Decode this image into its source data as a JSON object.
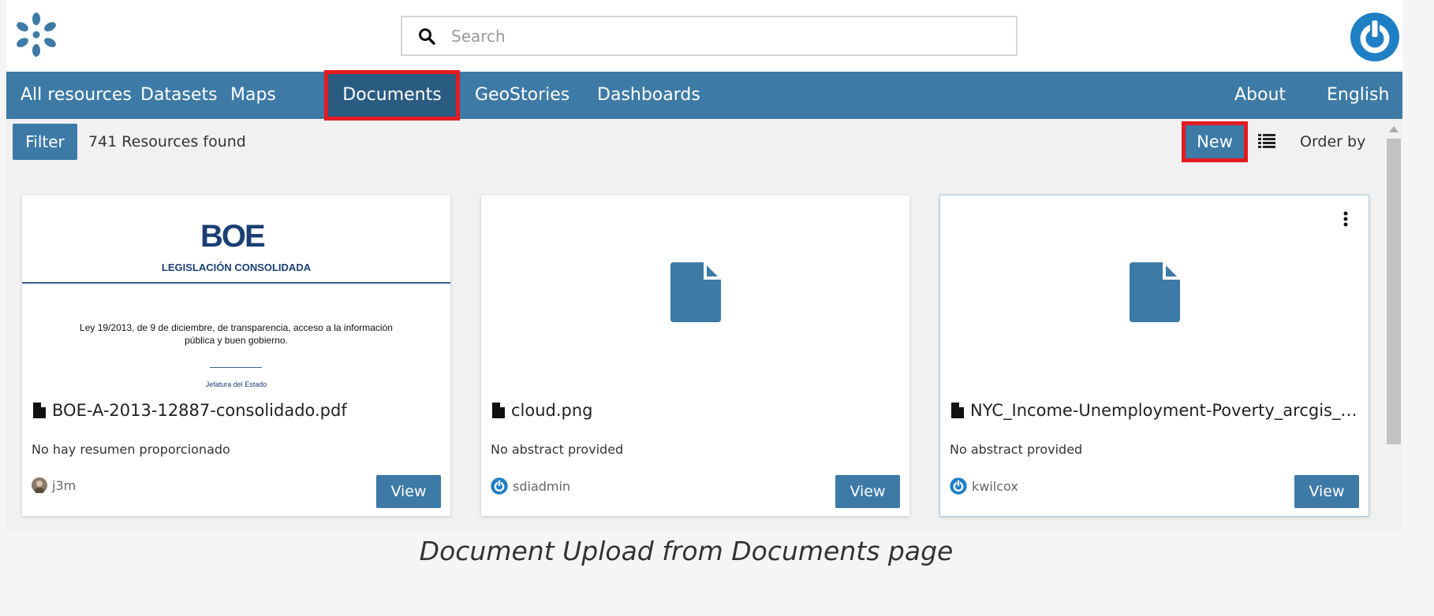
{
  "header": {
    "search_placeholder": "Search",
    "logo_icon": "geonode-logo-icon",
    "user_icon": "power-user-icon",
    "accent_color": "#3d7aa6"
  },
  "nav": {
    "items": [
      {
        "label": "All resources"
      },
      {
        "label": "Datasets"
      },
      {
        "label": "Maps"
      },
      {
        "label": "Documents",
        "active": true
      },
      {
        "label": "GeoStories"
      },
      {
        "label": "Dashboards"
      }
    ],
    "right": [
      {
        "label": "About"
      },
      {
        "label": "English"
      }
    ],
    "highlight_color": "#e21b22"
  },
  "toolbar": {
    "filter_label": "Filter",
    "count_text": "741 Resources found",
    "new_label": "New",
    "order_label": "Order by"
  },
  "cards": [
    {
      "title": "BOE-A-2013-12887-consolidado.pdf",
      "abstract": "No hay resumen proporcionado",
      "owner": "j3m",
      "view_label": "View",
      "thumbnail": {
        "logo_text": "BOE",
        "subtitle": "LEGISLACIÓN CONSOLIDADA",
        "law_text": "Ley 19/2013, de 9 de diciembre, de transparencia, acceso a la información pública y buen gobierno.",
        "issuer": "Jefatura del Estado"
      }
    },
    {
      "title": "cloud.png",
      "abstract": "No abstract provided",
      "owner": "sdiadmin",
      "view_label": "View"
    },
    {
      "title": "NYC_Income-Unemployment-Poverty_arcgis_map.png",
      "abstract": "No abstract provided",
      "owner": "kwilcox",
      "view_label": "View"
    }
  ],
  "caption": "Document Upload from Documents page"
}
